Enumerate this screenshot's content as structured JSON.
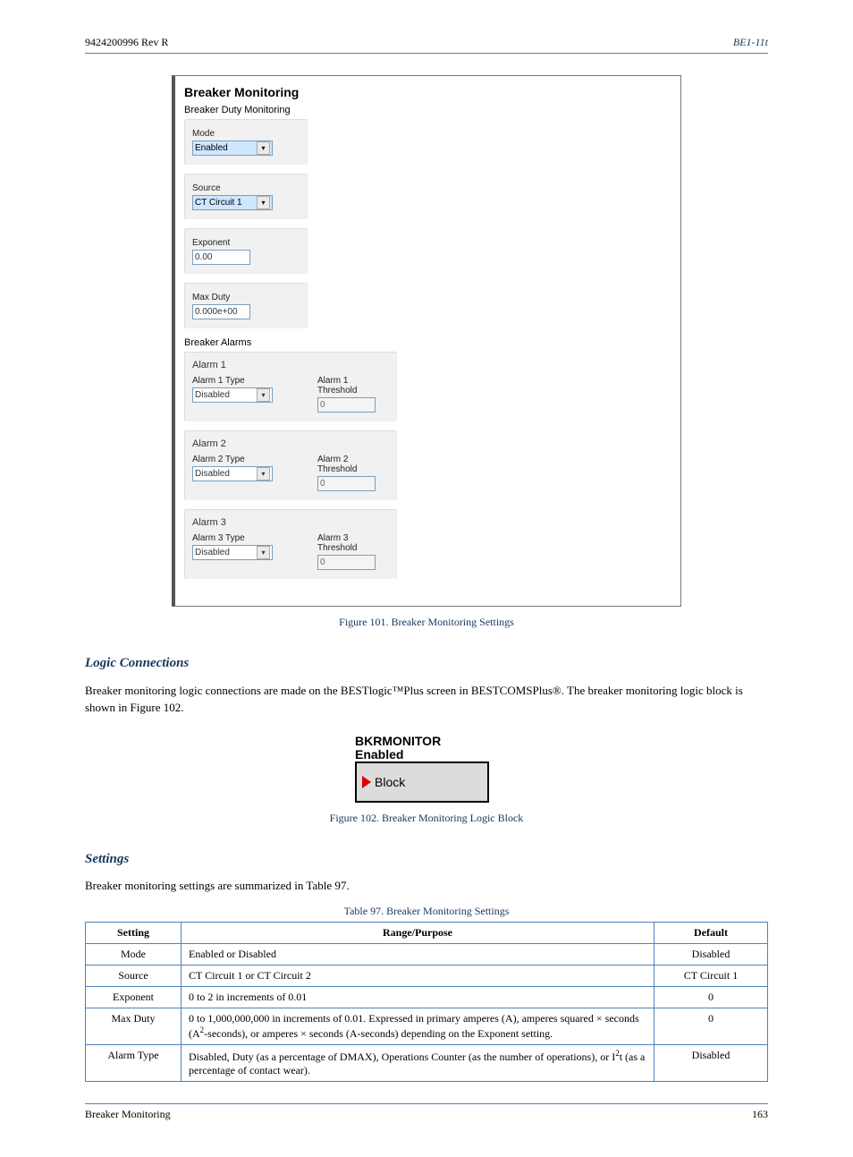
{
  "page_header": {
    "left": "9424200996 Rev R",
    "right": "BE1-11t"
  },
  "panel": {
    "title": "Breaker Monitoring",
    "duty_title": "Breaker Duty Monitoring",
    "mode_label": "Mode",
    "mode_value": "Enabled",
    "source_label": "Source",
    "source_value": "CT Circuit 1",
    "exponent_label": "Exponent",
    "exponent_value": "0.00",
    "max_duty_label": "Max Duty",
    "max_duty_value": "0.000e+00",
    "alarms_title": "Breaker Alarms",
    "alarms": [
      {
        "name": "Alarm 1",
        "type_label": "Alarm 1 Type",
        "type_value": "Disabled",
        "thresh_label": "Alarm 1 Threshold",
        "thresh_value": "0"
      },
      {
        "name": "Alarm 2",
        "type_label": "Alarm 2 Type",
        "type_value": "Disabled",
        "thresh_label": "Alarm 2 Threshold",
        "thresh_value": "0"
      },
      {
        "name": "Alarm 3",
        "type_label": "Alarm 3 Type",
        "type_value": "Disabled",
        "thresh_label": "Alarm 3 Threshold",
        "thresh_value": "0"
      }
    ]
  },
  "figure_caption": "Figure 101. Breaker Monitoring Settings",
  "logic_heading": "Logic Connections",
  "logic_intro": "Breaker monitoring logic connections are made on the BESTlogic™Plus screen in BESTCOMSPlus®. The breaker monitoring logic block is shown in Figure 102.",
  "logic_block": {
    "title1": "BKRMONITOR",
    "title2": "Enabled",
    "input": "Block"
  },
  "logic_caption": "Figure 102. Breaker Monitoring Logic Block",
  "settings_heading": "Settings",
  "settings_intro": "Breaker monitoring settings are summarized in Table 97.",
  "table_caption": "Table 97. Breaker Monitoring Settings",
  "table": {
    "headers": [
      "Setting",
      "Range/Purpose",
      "Default"
    ],
    "rows": [
      {
        "setting": "Mode",
        "desc": "Enabled or Disabled",
        "default": "Disabled"
      },
      {
        "setting": "Source",
        "desc": "CT Circuit 1 or CT Circuit 2",
        "default": "CT Circuit 1"
      },
      {
        "setting": "Exponent",
        "desc": "0 to 2 in increments of 0.01",
        "default": "0"
      },
      {
        "setting": "Max Duty",
        "desc_html": "0 to 1,000,000,000 in increments of 0.01. Expressed in primary amperes (A), amperes squared × seconds (A<sup>2</sup>-seconds), or amperes × seconds (A-seconds) depending on the Exponent setting.",
        "default": "0"
      },
      {
        "setting": "Alarm Type",
        "desc_html": "Disabled, Duty (as a percentage of DMAX), Operations Counter (as the number of operations), or I<sup>2</sup>t (as a percentage of contact wear).",
        "default": "Disabled"
      }
    ]
  },
  "page_footer": {
    "left": "Breaker Monitoring",
    "right": "163"
  }
}
